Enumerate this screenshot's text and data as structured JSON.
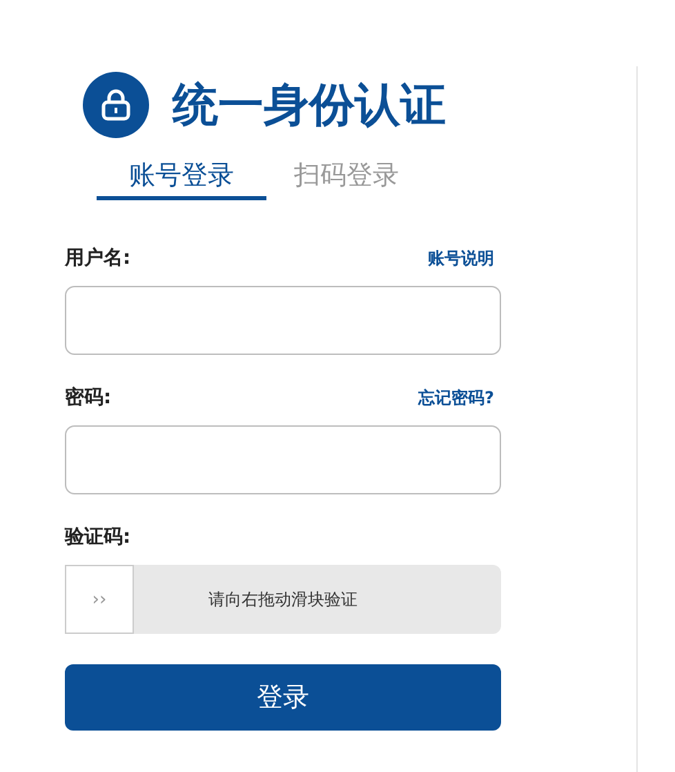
{
  "header": {
    "title": "统一身份认证"
  },
  "tabs": [
    {
      "label": "账号登录",
      "selected": true
    },
    {
      "label": "扫码登录",
      "selected": false
    }
  ],
  "fields": [
    {
      "label": "用户名:",
      "link": "账号说明"
    },
    {
      "label": "密码:",
      "link": "忘记密码?"
    }
  ],
  "captcha": {
    "label": "验证码:",
    "handle": "››",
    "hint": "请向右拖动滑块验证"
  },
  "submit": "登录"
}
